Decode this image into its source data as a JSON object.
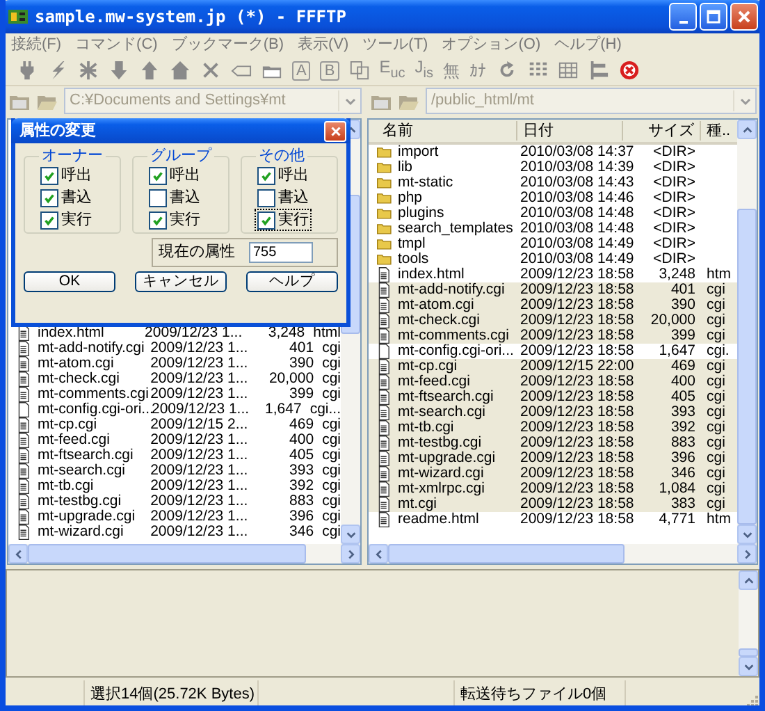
{
  "window": {
    "title": "sample.mw-system.jp (*) - FFFTP"
  },
  "menu": [
    "接続(F)",
    "コマンド(C)",
    "ブックマーク(B)",
    "表示(V)",
    "ツール(T)",
    "オプション(O)",
    "ヘルプ(H)"
  ],
  "toolbar": [
    {
      "kind": "plug"
    },
    {
      "kind": "bolt"
    },
    {
      "kind": "asterisk"
    },
    {
      "kind": "arrow-down"
    },
    {
      "kind": "arrow-up"
    },
    {
      "kind": "house"
    },
    {
      "kind": "cross"
    },
    {
      "kind": "tag"
    },
    {
      "kind": "folder"
    },
    {
      "kind": "boxed",
      "label": "A"
    },
    {
      "kind": "boxed",
      "label": "B"
    },
    {
      "kind": "copy"
    },
    {
      "kind": "label",
      "label": "E$_{uc}$"
    },
    {
      "kind": "label",
      "label": "J$_{is}$"
    },
    {
      "kind": "label",
      "label": "無"
    },
    {
      "kind": "label",
      "label": "ｶﾅ"
    },
    {
      "kind": "refresh"
    },
    {
      "kind": "list"
    },
    {
      "kind": "table"
    },
    {
      "kind": "tree"
    },
    {
      "kind": "stop"
    }
  ],
  "local": {
    "path": "C:¥Documents and Settings¥mt",
    "disabled": true,
    "rows": [
      {
        "kind": "file",
        "name": "index.html",
        "date": "2009/12/23 1...",
        "size": "3,248",
        "type": "html"
      },
      {
        "kind": "file",
        "name": "mt-add-notify.cgi",
        "date": "2009/12/23 1...",
        "size": "401",
        "type": "cgi"
      },
      {
        "kind": "file",
        "name": "mt-atom.cgi",
        "date": "2009/12/23 1...",
        "size": "390",
        "type": "cgi"
      },
      {
        "kind": "file",
        "name": "mt-check.cgi",
        "date": "2009/12/23 1...",
        "size": "20,000",
        "type": "cgi"
      },
      {
        "kind": "file",
        "name": "mt-comments.cgi",
        "date": "2009/12/23 1...",
        "size": "399",
        "type": "cgi"
      },
      {
        "kind": "blank",
        "name": "mt-config.cgi-ori...",
        "date": "2009/12/23 1...",
        "size": "1,647",
        "type": "cgi..."
      },
      {
        "kind": "file",
        "name": "mt-cp.cgi",
        "date": "2009/12/15 2...",
        "size": "469",
        "type": "cgi"
      },
      {
        "kind": "file",
        "name": "mt-feed.cgi",
        "date": "2009/12/23 1...",
        "size": "400",
        "type": "cgi"
      },
      {
        "kind": "file",
        "name": "mt-ftsearch.cgi",
        "date": "2009/12/23 1...",
        "size": "405",
        "type": "cgi"
      },
      {
        "kind": "file",
        "name": "mt-search.cgi",
        "date": "2009/12/23 1...",
        "size": "393",
        "type": "cgi"
      },
      {
        "kind": "file",
        "name": "mt-tb.cgi",
        "date": "2009/12/23 1...",
        "size": "392",
        "type": "cgi"
      },
      {
        "kind": "file",
        "name": "mt-testbg.cgi",
        "date": "2009/12/23 1...",
        "size": "883",
        "type": "cgi"
      },
      {
        "kind": "file",
        "name": "mt-upgrade.cgi",
        "date": "2009/12/23 1...",
        "size": "396",
        "type": "cgi"
      },
      {
        "kind": "file",
        "name": "mt-wizard.cgi",
        "date": "2009/12/23 1...",
        "size": "346",
        "type": "cgi"
      }
    ]
  },
  "remote": {
    "path": "/public_html/mt",
    "columns": [
      "名前",
      "日付",
      "サイズ",
      "種.."
    ],
    "rows": [
      {
        "kind": "folder",
        "name": "import",
        "date": "2010/03/08 14:37",
        "size": "<DIR>",
        "type": "",
        "selected": false
      },
      {
        "kind": "folder",
        "name": "lib",
        "date": "2010/03/08 14:39",
        "size": "<DIR>",
        "type": "",
        "selected": false
      },
      {
        "kind": "folder",
        "name": "mt-static",
        "date": "2010/03/08 14:43",
        "size": "<DIR>",
        "type": "",
        "selected": false
      },
      {
        "kind": "folder",
        "name": "php",
        "date": "2010/03/08 14:46",
        "size": "<DIR>",
        "type": "",
        "selected": false
      },
      {
        "kind": "folder",
        "name": "plugins",
        "date": "2010/03/08 14:48",
        "size": "<DIR>",
        "type": "",
        "selected": false
      },
      {
        "kind": "folder",
        "name": "search_templates",
        "date": "2010/03/08 14:48",
        "size": "<DIR>",
        "type": "",
        "selected": false
      },
      {
        "kind": "folder",
        "name": "tmpl",
        "date": "2010/03/08 14:49",
        "size": "<DIR>",
        "type": "",
        "selected": false
      },
      {
        "kind": "folder",
        "name": "tools",
        "date": "2010/03/08 14:49",
        "size": "<DIR>",
        "type": "",
        "selected": false
      },
      {
        "kind": "file",
        "name": "index.html",
        "date": "2009/12/23 18:58",
        "size": "3,248",
        "type": "htm",
        "selected": false
      },
      {
        "kind": "file",
        "name": "mt-add-notify.cgi",
        "date": "2009/12/23 18:58",
        "size": "401",
        "type": "cgi",
        "selected": true
      },
      {
        "kind": "file",
        "name": "mt-atom.cgi",
        "date": "2009/12/23 18:58",
        "size": "390",
        "type": "cgi",
        "selected": true
      },
      {
        "kind": "file",
        "name": "mt-check.cgi",
        "date": "2009/12/23 18:58",
        "size": "20,000",
        "type": "cgi",
        "selected": true
      },
      {
        "kind": "file",
        "name": "mt-comments.cgi",
        "date": "2009/12/23 18:58",
        "size": "399",
        "type": "cgi",
        "selected": true
      },
      {
        "kind": "blank",
        "name": "mt-config.cgi-ori...",
        "date": "2009/12/23 18:58",
        "size": "1,647",
        "type": "cgi.",
        "selected": false
      },
      {
        "kind": "file",
        "name": "mt-cp.cgi",
        "date": "2009/12/15 22:00",
        "size": "469",
        "type": "cgi",
        "selected": true
      },
      {
        "kind": "file",
        "name": "mt-feed.cgi",
        "date": "2009/12/23 18:58",
        "size": "400",
        "type": "cgi",
        "selected": true
      },
      {
        "kind": "file",
        "name": "mt-ftsearch.cgi",
        "date": "2009/12/23 18:58",
        "size": "405",
        "type": "cgi",
        "selected": true
      },
      {
        "kind": "file",
        "name": "mt-search.cgi",
        "date": "2009/12/23 18:58",
        "size": "393",
        "type": "cgi",
        "selected": true
      },
      {
        "kind": "file",
        "name": "mt-tb.cgi",
        "date": "2009/12/23 18:58",
        "size": "392",
        "type": "cgi",
        "selected": true
      },
      {
        "kind": "file",
        "name": "mt-testbg.cgi",
        "date": "2009/12/23 18:58",
        "size": "883",
        "type": "cgi",
        "selected": true
      },
      {
        "kind": "file",
        "name": "mt-upgrade.cgi",
        "date": "2009/12/23 18:58",
        "size": "396",
        "type": "cgi",
        "selected": true
      },
      {
        "kind": "file",
        "name": "mt-wizard.cgi",
        "date": "2009/12/23 18:58",
        "size": "346",
        "type": "cgi",
        "selected": true
      },
      {
        "kind": "file",
        "name": "mt-xmlrpc.cgi",
        "date": "2009/12/23 18:58",
        "size": "1,084",
        "type": "cgi",
        "selected": true
      },
      {
        "kind": "file",
        "name": "mt.cgi",
        "date": "2009/12/23 18:58",
        "size": "383",
        "type": "cgi",
        "selected": true
      },
      {
        "kind": "file",
        "name": "readme.html",
        "date": "2009/12/23 18:58",
        "size": "4,771",
        "type": "htm",
        "selected": false
      }
    ]
  },
  "dialog": {
    "title": "属性の変更",
    "groups": [
      {
        "title": "オーナー",
        "items": [
          {
            "label": "呼出",
            "checked": true,
            "focused": false
          },
          {
            "label": "書込",
            "checked": true,
            "focused": false
          },
          {
            "label": "実行",
            "checked": true,
            "focused": false
          }
        ]
      },
      {
        "title": "グループ",
        "items": [
          {
            "label": "呼出",
            "checked": true,
            "focused": false
          },
          {
            "label": "書込",
            "checked": false,
            "focused": false
          },
          {
            "label": "実行",
            "checked": true,
            "focused": false
          }
        ]
      },
      {
        "title": "その他",
        "items": [
          {
            "label": "呼出",
            "checked": true,
            "focused": false
          },
          {
            "label": "書込",
            "checked": false,
            "focused": false
          },
          {
            "label": "実行",
            "checked": true,
            "focused": true
          }
        ]
      }
    ],
    "current_label": "現在の属性",
    "current_value": "755",
    "buttons": [
      "OK",
      "キャンセル",
      "ヘルプ"
    ]
  },
  "status_bar": [
    "選択14個(25.72K Bytes)",
    "転送待ちファイル0個"
  ]
}
